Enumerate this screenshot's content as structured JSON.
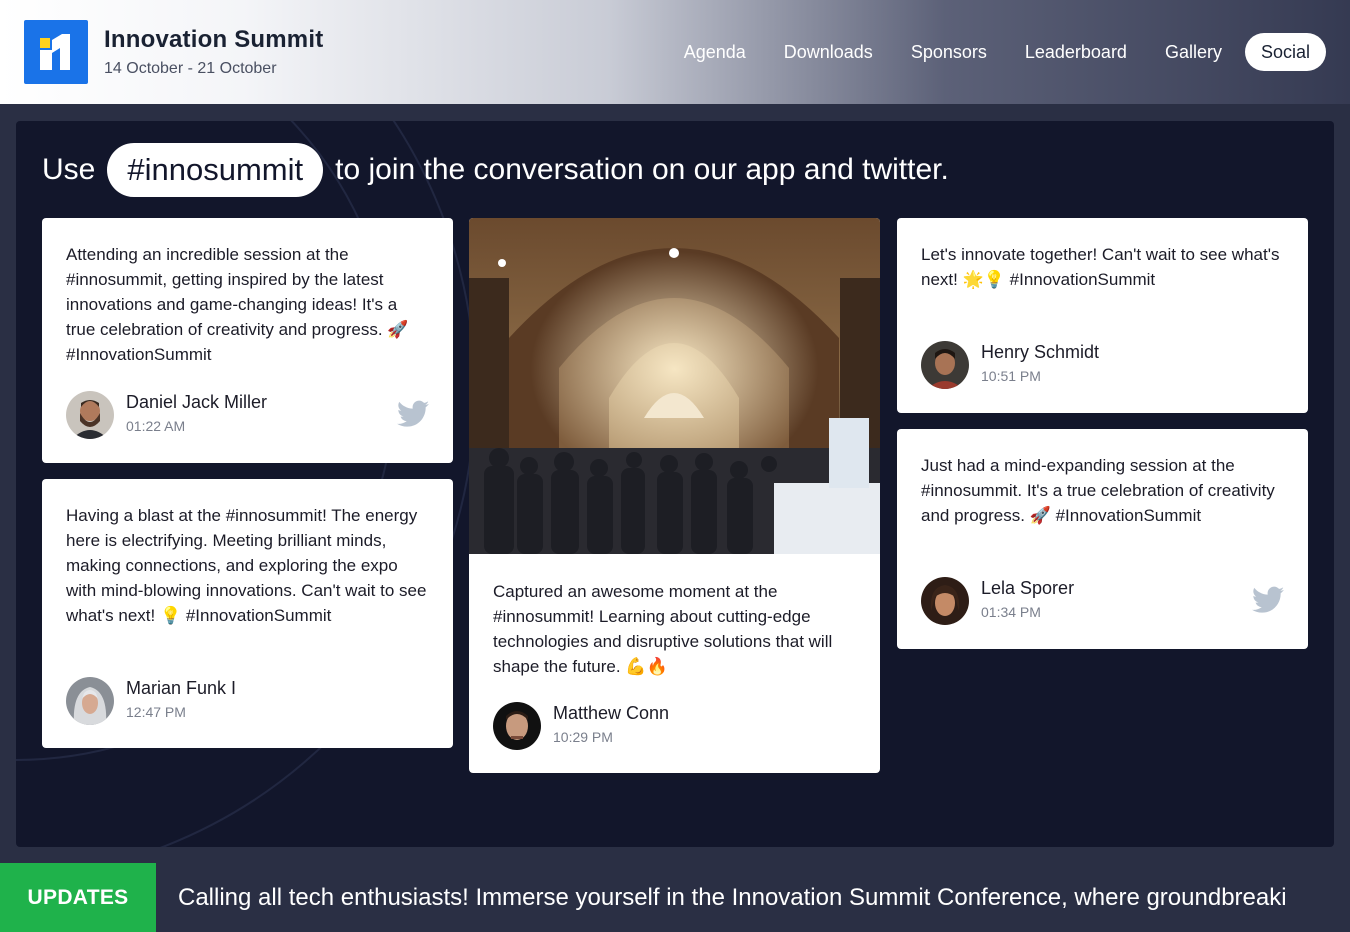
{
  "header": {
    "title": "Innovation Summit",
    "dates": "14 October - 21 October",
    "nav": [
      {
        "label": "Agenda"
      },
      {
        "label": "Downloads"
      },
      {
        "label": "Sponsors"
      },
      {
        "label": "Leaderboard"
      },
      {
        "label": "Gallery"
      },
      {
        "label": "Social",
        "active": true
      }
    ]
  },
  "headline": {
    "prefix": "Use",
    "hashtag": "#innosummit",
    "suffix": "to join the conversation on our app and twitter."
  },
  "posts": [
    {
      "text": "Attending an incredible session at the #innosummit, getting inspired by the latest innovations and game-changing ideas! It's a true celebration of creativity and progress. 🚀 #InnovationSummit",
      "author": "Daniel Jack Miller",
      "time": "01:22 AM",
      "source_icon": "twitter-icon"
    },
    {
      "text": "Having a blast at the #innosummit! The energy here is electrifying. Meeting brilliant minds, making connections, and exploring the expo with mind-blowing innovations. Can't wait to see what's next! 💡 #InnovationSummit",
      "author": "Marian Funk I",
      "time": "12:47 PM"
    },
    {
      "text": "Captured an awesome moment at the #innosummit! Learning about cutting-edge technologies and disruptive solutions that will shape the future. 💪🔥",
      "author": "Matthew Conn",
      "time": "10:29 PM",
      "image": "expo-hall-photo"
    },
    {
      "text": "Let's innovate together! Can't wait to see what's next! 🌟💡 #InnovationSummit",
      "author": "Henry Schmidt",
      "time": "10:51 PM"
    },
    {
      "text": "Just had a mind-expanding session at the #innosummit. It's a true celebration of creativity and progress. 🚀 #InnovationSummit",
      "author": "Lela Sporer",
      "time": "01:34 PM",
      "source_icon": "twitter-icon"
    }
  ],
  "ticker": {
    "label": "UPDATES",
    "text": "Calling all tech enthusiasts! Immerse yourself in the Innovation Summit Conference, where groundbreaki"
  },
  "colors": {
    "panel_bg": "#12162b",
    "brand_blue": "#1a73e8",
    "updates_green": "#1fb24b",
    "twitter_gray": "#b8c3d0"
  }
}
